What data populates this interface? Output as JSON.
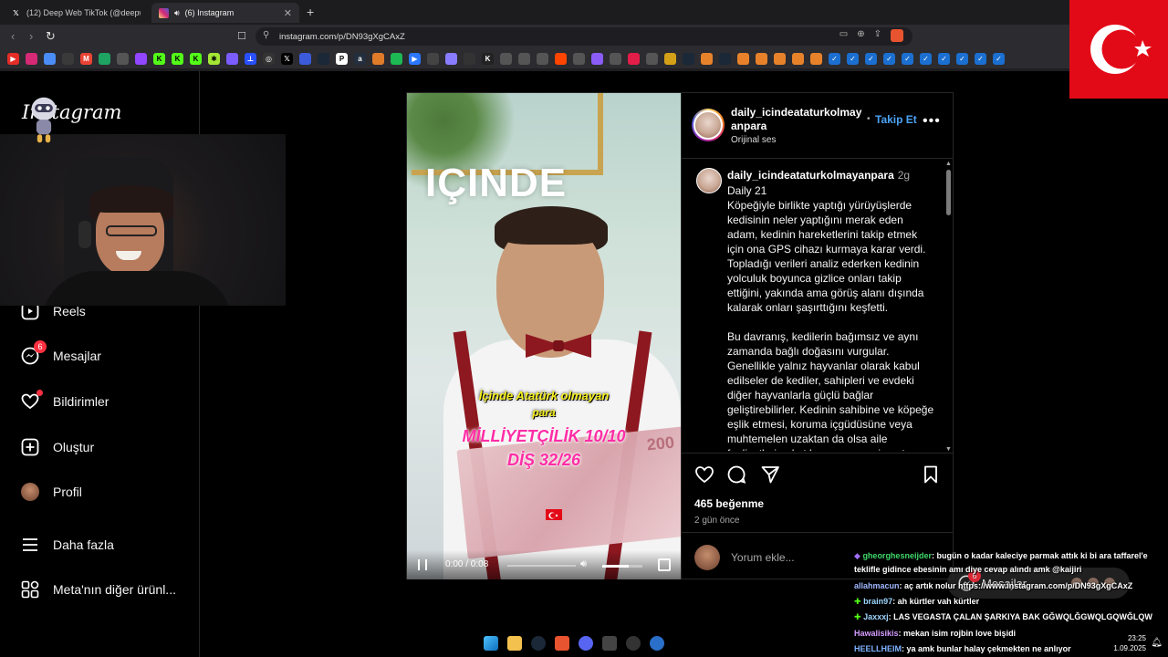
{
  "browser": {
    "tabs": [
      {
        "title": "(12) Deep Web TikTok (@deepwebtik",
        "icon": "x-icon",
        "active": false
      },
      {
        "title": "(6) Instagram",
        "icon": "instagram-icon",
        "active": true
      }
    ],
    "url": "instagram.com/p/DN93gXgCAxZ"
  },
  "sidebar": {
    "logo": "Instagram",
    "items": [
      {
        "label": "Reels",
        "icon": "reels-icon"
      },
      {
        "label": "Mesajlar",
        "icon": "messenger-icon",
        "badge": "6"
      },
      {
        "label": "Bildirimler",
        "icon": "heart-icon",
        "dot": true
      },
      {
        "label": "Oluştur",
        "icon": "plus-square-icon"
      },
      {
        "label": "Profil",
        "icon": "avatar-icon"
      },
      {
        "label": "Daha fazla",
        "icon": "menu-icon"
      },
      {
        "label": "Meta'nın diğer ürünl...",
        "icon": "grid-icon"
      }
    ]
  },
  "post": {
    "video": {
      "overlay_word": "IÇINDE",
      "caption_line1": "İçinde Atatürk olmayan",
      "caption_line2": "para",
      "caption_line3": "MİLLİYETÇİLİK 10/10",
      "caption_line4": "DİŞ 32/26",
      "banknote_value": "200",
      "time": "0:00 / 0:08",
      "progress": 0.0,
      "volume": 0.65
    },
    "author": {
      "username_line1": "daily_icindeataturkolmay",
      "username_line2": "anpara",
      "follow_label": "Takip Et",
      "audio_label": "Orijinal ses"
    },
    "caption": {
      "username": "daily_icindeataturkolmayanpara",
      "ago": "2g",
      "text": "Daily 21\nKöpeğiyle birlikte yaptığı yürüyüşlerde kedisinin neler yaptığını merak eden adam, kedinin hareketlerini takip etmek için ona GPS cihazı kurmaya karar verdi. Topladığı verileri analiz ederken kedinin yolculuk boyunca gizlice onları takip ettiğini, yakında ama görüş alanı dışında kalarak onları şaşırttığını keşfetti.\n\nBu davranış, kedilerin bağımsız ve aynı zamanda bağlı doğasını vurgular. Genellikle yalnız hayvanlar olarak kabul edilseler de kediler, sahipleri ve evdeki diğer hayvanlarla güçlü bağlar geliştirebilirler. Kedinin sahibine ve köpeğe eşlik etmesi, koruma içgüdüsüne veya muhtemelen uzaktan da olsa aile faaliyetlerine katılma arzusuna işaret"
    },
    "likes": "465 beğenme",
    "date": "2 gün önce",
    "comment_placeholder": "Yorum ekle..."
  },
  "messages_pill": {
    "label": "Mesajlar",
    "badge": "6"
  },
  "chat": [
    {
      "user": "gheorghesneijder",
      "color": "#3fd86a",
      "text": ": bugün o kadar kaleciye parmak attık ki bi ara taffarel'e teklifle gidince ebesinin amı diye cevap alındı amk @kaijiri"
    },
    {
      "user": "allahmacun",
      "color": "#a0b8ff",
      "text": ": aç artık nolur https://www.instagram.com/p/DN93gXgCAxZ"
    },
    {
      "user": "brain97",
      "color": "#9ed6ff",
      "text": ": ah kürtler vah kürtler"
    },
    {
      "user": "Jaxxxj",
      "color": "#9ed6ff",
      "text": ": LAS VEGASTA ÇALAN ŞARKIYA BAK GĞWQLĞGWQLGQWĞLQW"
    },
    {
      "user": "Hawalisikis",
      "color": "#d59bff",
      "text": ": mekan isim rojbin love bişidi"
    },
    {
      "user": "HEELLHEIM",
      "color": "#7fb3ff",
      "text": ": ya amk bunlar halay çekmekten ne anlıyor"
    }
  ],
  "taskbar": {
    "time": "23:25",
    "date": "1.09.2025"
  },
  "colors": {
    "ig_blue": "#4ba3f5",
    "notif_red": "#ff3040",
    "flag_red": "#e30a17"
  }
}
